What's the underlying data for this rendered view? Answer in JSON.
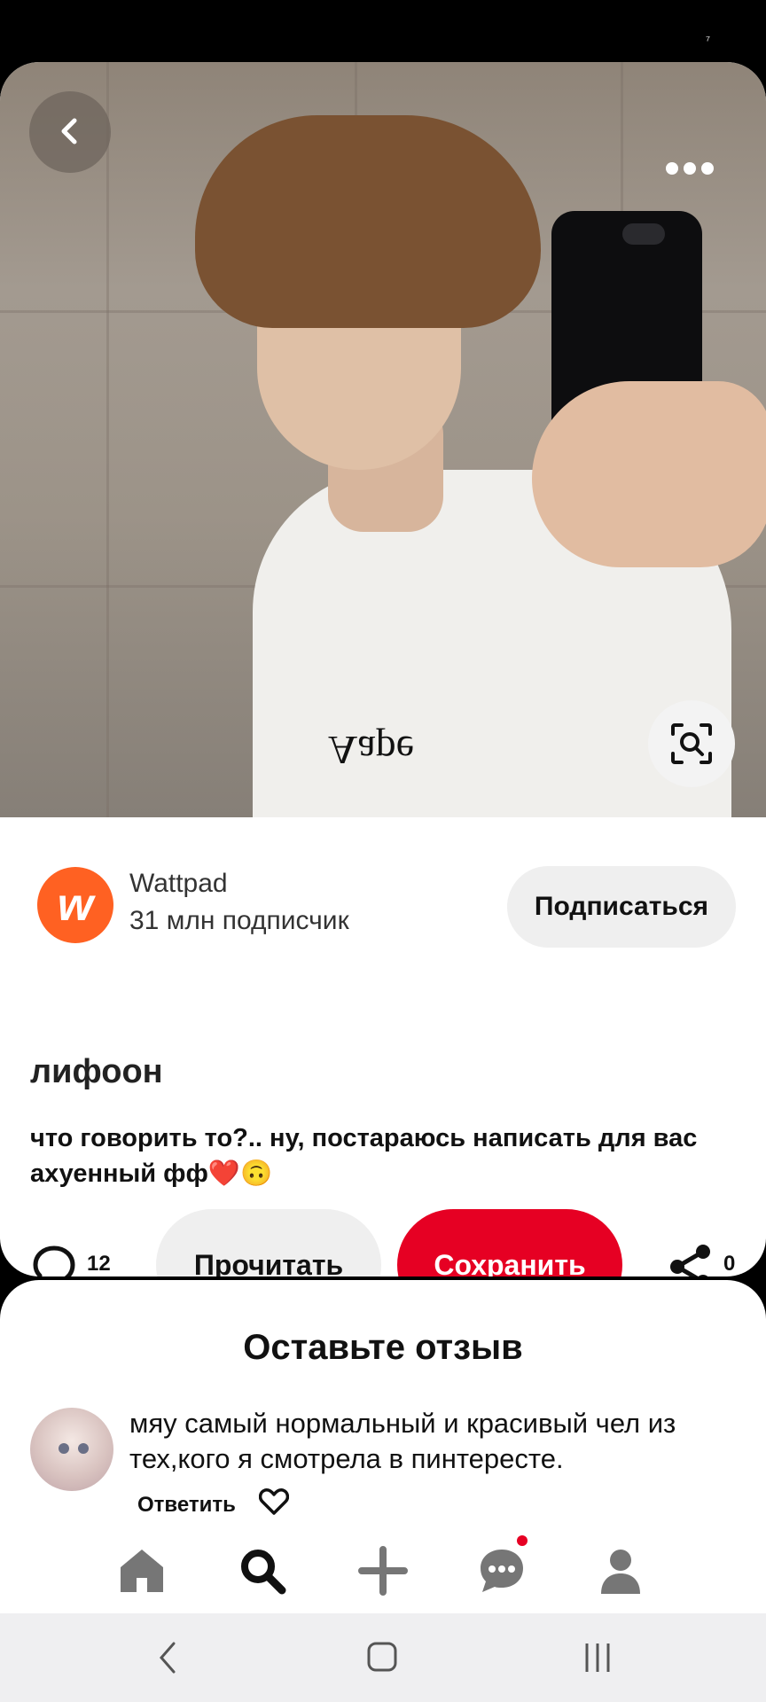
{
  "creator": {
    "name": "Wattpad",
    "subscribers": "31 млн подписчик",
    "logo_letter": "w",
    "subscribe_label": "Подписаться"
  },
  "pin": {
    "title": "лифоон",
    "description": "что говорить то?.. ну, постараюсь написать для вас ахуенный фф❤️🙃",
    "shirt_print": "Aape"
  },
  "actions": {
    "comment_count": "12",
    "read_label": "Прочитать",
    "save_label": "Сохранить",
    "share_count": "0"
  },
  "reviews": {
    "title": "Оставьте отзыв",
    "items": [
      {
        "text": "мяу самый нормальный и красивый чел из тех,кого я смотрела в пинтересте.",
        "reply_label": "Ответить"
      }
    ]
  },
  "icons": {
    "back": "back-arrow-icon",
    "more": "more-dots-icon",
    "lens": "visual-search-icon",
    "comment": "comment-bubble-icon",
    "share": "share-icon",
    "like": "heart-icon",
    "nav": [
      "home-icon",
      "search-icon",
      "plus-icon",
      "chat-icon",
      "profile-icon"
    ]
  },
  "colors": {
    "accent": "#e60023",
    "brand_wattpad": "#ff6122",
    "nav_active": "#111111",
    "nav_inactive": "#767676"
  }
}
